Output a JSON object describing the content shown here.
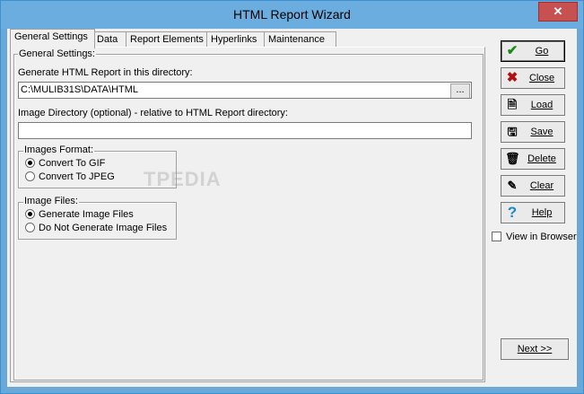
{
  "window": {
    "title": "HTML Report Wizard",
    "close_glyph": "✕"
  },
  "tabs": [
    {
      "label": "General Settings"
    },
    {
      "label": "Data"
    },
    {
      "label": "Report Elements"
    },
    {
      "label": "Hyperlinks"
    },
    {
      "label": "Maintenance"
    }
  ],
  "panel": {
    "group_title": "General Settings:",
    "dir_label": "Generate HTML Report in this directory:",
    "dir_value": "C:\\MULIB31S\\DATA\\HTML",
    "browse_label": "...",
    "img_dir_label": "Image Directory (optional) - relative to HTML Report directory:",
    "img_dir_value": "",
    "images_format": {
      "title": "Images Format:",
      "options": [
        "Convert To GIF",
        "Convert To JPEG"
      ],
      "selected": 0
    },
    "image_files": {
      "title": "Image Files:",
      "options": [
        "Generate Image Files",
        "Do Not Generate Image Files"
      ],
      "selected": 0
    },
    "watermark": "TPEDIA"
  },
  "side_buttons": [
    {
      "label": "Go",
      "icon": "check-icon",
      "glyph": "✔",
      "color": "#1a8a1a"
    },
    {
      "label": "Close",
      "icon": "x-icon",
      "glyph": "✖",
      "color": "#b01010"
    },
    {
      "label": "Load",
      "icon": "document-icon",
      "glyph": "🗎",
      "color": "#333333"
    },
    {
      "label": "Save",
      "icon": "disk-icon",
      "glyph": "🖫",
      "color": "#333333"
    },
    {
      "label": "Delete",
      "icon": "trash-icon",
      "glyph": "🗑",
      "color": "#333333"
    },
    {
      "label": "Clear",
      "icon": "broom-icon",
      "glyph": "✎",
      "color": "#3a3a3a"
    },
    {
      "label": "Help",
      "icon": "question-icon",
      "glyph": "?",
      "color": "#1a8ac8"
    }
  ],
  "view_in_browser": {
    "label": "View in Browser",
    "checked": false
  },
  "next_button": {
    "label": "Next >>"
  }
}
